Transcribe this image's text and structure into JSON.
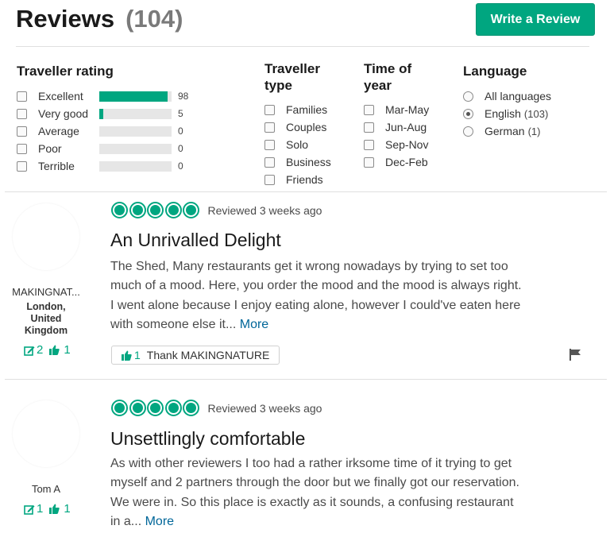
{
  "header": {
    "title": "Reviews",
    "count": "(104)",
    "write_button": "Write a Review"
  },
  "filters": {
    "rating": {
      "title": "Traveller rating",
      "items": [
        {
          "label": "Excellent",
          "count": "98",
          "fraction": 0.95
        },
        {
          "label": "Very good",
          "count": "5",
          "fraction": 0.05
        },
        {
          "label": "Average",
          "count": "0",
          "fraction": 0
        },
        {
          "label": "Poor",
          "count": "0",
          "fraction": 0
        },
        {
          "label": "Terrible",
          "count": "0",
          "fraction": 0
        }
      ]
    },
    "type": {
      "title_line1": "Traveller",
      "title_line2": "type",
      "items": [
        "Families",
        "Couples",
        "Solo",
        "Business",
        "Friends"
      ]
    },
    "time": {
      "title_line1": "Time of",
      "title_line2": "year",
      "items": [
        "Mar-May",
        "Jun-Aug",
        "Sep-Nov",
        "Dec-Feb"
      ]
    },
    "language": {
      "title": "Language",
      "items": [
        {
          "label": "All languages",
          "count": "",
          "selected": false
        },
        {
          "label": "English",
          "count": "(103)",
          "selected": true
        },
        {
          "label": "German",
          "count": "(1)",
          "selected": false
        }
      ]
    }
  },
  "reviews": [
    {
      "username": "MAKINGNAT...",
      "location_line1": "London,",
      "location_line2": "United",
      "location_line3": "Kingdom",
      "contributions": "2",
      "helpful_votes": "1",
      "rating": 5,
      "date": "Reviewed 3 weeks ago",
      "title": "An Unrivalled Delight",
      "body_line1": "The Shed, Many restaurants get it wrong nowadays by trying to set too",
      "body_line2": "much of a mood. Here, you order the mood and the mood is always right.",
      "body_line3": "I went alone because I enjoy eating alone, however I could've eaten here",
      "body_line4": "with someone else it...",
      "more": "More",
      "thank_count": "1",
      "thank_label": "Thank MAKINGNATURE"
    },
    {
      "username": "Tom A",
      "contributions": "1",
      "helpful_votes": "1",
      "rating": 5,
      "date": "Reviewed 3 weeks ago",
      "title": "Unsettlingly comfortable",
      "body_line1": "As with other reviewers I too had a rather irksome time of it trying to get",
      "body_line2": "myself and 2 partners through the door but we finally got our reservation.",
      "body_line3": "We were in. So this place is exactly as it sounds, a confusing restaurant",
      "body_line4": "in a...",
      "more": "More"
    }
  ],
  "colors": {
    "accent": "#00a680",
    "link": "#006699"
  }
}
